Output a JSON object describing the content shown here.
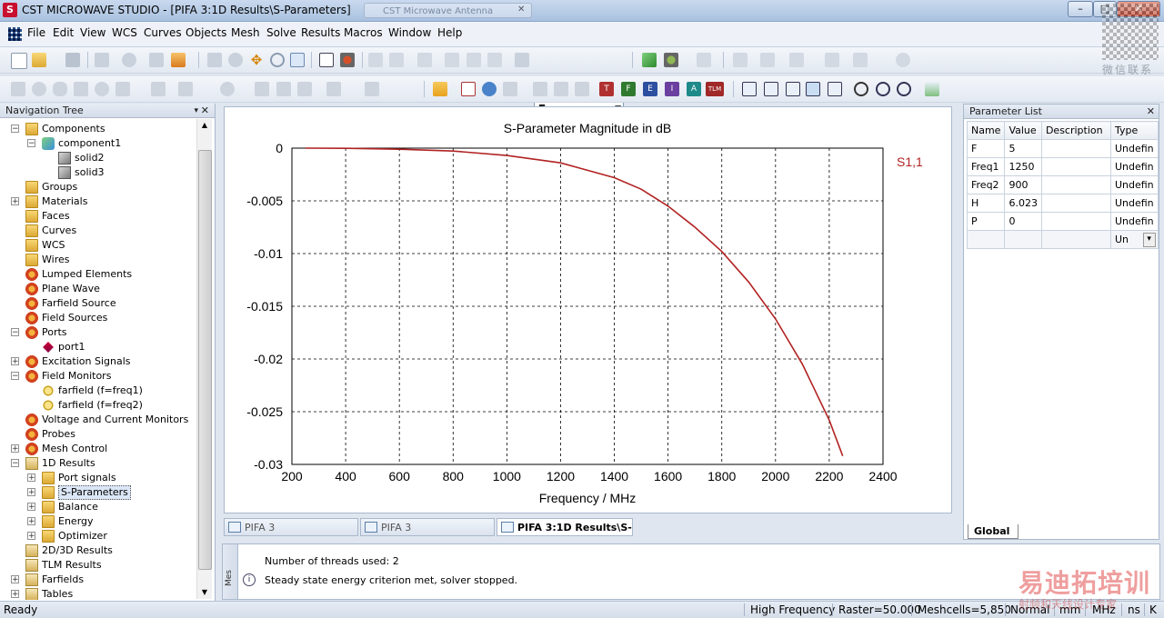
{
  "window": {
    "title": "CST MICROWAVE STUDIO - [PIFA 3:1D Results\\S-Parameters]",
    "ghost_tab": "CST Microwave Antenna",
    "logo": "S"
  },
  "menu": [
    "File",
    "Edit",
    "View",
    "WCS",
    "Curves",
    "Objects",
    "Mesh",
    "Solve",
    "Results",
    "Macros",
    "Window",
    "Help"
  ],
  "toolbar": {
    "mode_value": "Free"
  },
  "nav_tree": {
    "title": "Navigation Tree",
    "items": [
      {
        "label": "Components",
        "level": 0,
        "exp": "-",
        "icon": "folder"
      },
      {
        "label": "component1",
        "level": 1,
        "exp": "-",
        "icon": "component"
      },
      {
        "label": "solid2",
        "level": 2,
        "exp": "",
        "icon": "solid"
      },
      {
        "label": "solid3",
        "level": 2,
        "exp": "",
        "icon": "solid"
      },
      {
        "label": "Groups",
        "level": 0,
        "exp": "",
        "icon": "folder"
      },
      {
        "label": "Materials",
        "level": 0,
        "exp": "+",
        "icon": "folder"
      },
      {
        "label": "Faces",
        "level": 0,
        "exp": "",
        "icon": "folder"
      },
      {
        "label": "Curves",
        "level": 0,
        "exp": "",
        "icon": "folder"
      },
      {
        "label": "WCS",
        "level": 0,
        "exp": "",
        "icon": "folder"
      },
      {
        "label": "Wires",
        "level": 0,
        "exp": "",
        "icon": "folder"
      },
      {
        "label": "Lumped Elements",
        "level": 0,
        "exp": "",
        "icon": "gear"
      },
      {
        "label": "Plane Wave",
        "level": 0,
        "exp": "",
        "icon": "gear"
      },
      {
        "label": "Farfield Source",
        "level": 0,
        "exp": "",
        "icon": "gear"
      },
      {
        "label": "Field Sources",
        "level": 0,
        "exp": "",
        "icon": "gear"
      },
      {
        "label": "Ports",
        "level": 0,
        "exp": "-",
        "icon": "gear"
      },
      {
        "label": "port1",
        "level": 1,
        "exp": "",
        "icon": "port"
      },
      {
        "label": "Excitation Signals",
        "level": 0,
        "exp": "+",
        "icon": "gear"
      },
      {
        "label": "Field Monitors",
        "level": 0,
        "exp": "-",
        "icon": "gear"
      },
      {
        "label": "farfield (f=freq1)",
        "level": 1,
        "exp": "",
        "icon": "farfield"
      },
      {
        "label": "farfield (f=freq2)",
        "level": 1,
        "exp": "",
        "icon": "farfield"
      },
      {
        "label": "Voltage and Current Monitors",
        "level": 0,
        "exp": "",
        "icon": "gear"
      },
      {
        "label": "Probes",
        "level": 0,
        "exp": "",
        "icon": "gear"
      },
      {
        "label": "Mesh Control",
        "level": 0,
        "exp": "+",
        "icon": "gear"
      },
      {
        "label": "1D Results",
        "level": 0,
        "exp": "-",
        "icon": "result"
      },
      {
        "label": "Port signals",
        "level": 1,
        "exp": "+",
        "icon": "folder"
      },
      {
        "label": "S-Parameters",
        "level": 1,
        "exp": "+",
        "icon": "folder",
        "selected": true
      },
      {
        "label": "Balance",
        "level": 1,
        "exp": "+",
        "icon": "folder"
      },
      {
        "label": "Energy",
        "level": 1,
        "exp": "+",
        "icon": "folder"
      },
      {
        "label": "Optimizer",
        "level": 1,
        "exp": "+",
        "icon": "folder"
      },
      {
        "label": "2D/3D Results",
        "level": 0,
        "exp": "",
        "icon": "result"
      },
      {
        "label": "TLM Results",
        "level": 0,
        "exp": "",
        "icon": "result"
      },
      {
        "label": "Farfields",
        "level": 0,
        "exp": "+",
        "icon": "result"
      },
      {
        "label": "Tables",
        "level": 0,
        "exp": "+",
        "icon": "result"
      }
    ]
  },
  "chart_data": {
    "type": "line",
    "title": "S-Parameter Magnitude in dB",
    "xlabel": "Frequency / MHz",
    "ylabel": "",
    "xlim": [
      200,
      2400
    ],
    "ylim": [
      -0.03,
      0
    ],
    "x_ticks": [
      "200",
      "400",
      "600",
      "800",
      "1000",
      "1200",
      "1400",
      "1600",
      "1800",
      "2000",
      "2200",
      "2400"
    ],
    "y_ticks": [
      "0",
      "-0.005",
      "-0.01",
      "-0.015",
      "-0.02",
      "-0.025",
      "-0.03"
    ],
    "grid": true,
    "legend_position": "right",
    "series": [
      {
        "name": "S1,1",
        "color": "#b22222",
        "x": [
          250,
          400,
          600,
          800,
          1000,
          1200,
          1400,
          1500,
          1600,
          1700,
          1800,
          1900,
          2000,
          2100,
          2200,
          2250
        ],
        "y": [
          0,
          -2e-05,
          -0.0001,
          -0.00028,
          -0.0007,
          -0.0014,
          -0.0028,
          -0.0039,
          -0.0055,
          -0.0075,
          -0.0098,
          -0.0127,
          -0.0162,
          -0.0205,
          -0.0258,
          -0.0292
        ]
      }
    ]
  },
  "doc_tabs": [
    {
      "label": "PIFA 3",
      "active": false
    },
    {
      "label": "PIFA 3",
      "active": false
    },
    {
      "label": "PIFA 3:1D Results\\S-...",
      "active": true
    }
  ],
  "parameters": {
    "title": "Parameter List",
    "headers": [
      "Name",
      "Value",
      "Description",
      "Type"
    ],
    "rows": [
      [
        "F",
        "5",
        "",
        "Undefin"
      ],
      [
        "Freq1",
        "1250",
        "",
        "Undefin"
      ],
      [
        "Freq2",
        "900",
        "",
        "Undefin"
      ],
      [
        "H",
        "6.023",
        "",
        "Undefin"
      ],
      [
        "P",
        "0",
        "",
        "Undefin"
      ],
      [
        "",
        "",
        "",
        "Un"
      ]
    ],
    "tab": "Global"
  },
  "messages": {
    "side_label": "Mes",
    "lines": [
      "Number of threads used: 2",
      "Steady state energy criterion met, solver stopped."
    ]
  },
  "status": {
    "left": "Ready",
    "items": [
      "High Frequency",
      "Raster=50.000",
      "Meshcells=5,850",
      "Normal",
      "mm",
      "MHz",
      "ns",
      "K"
    ]
  },
  "watermark": {
    "wechat": "微信联系",
    "brand": "易迪拓培训",
    "sub": "射频和天线设计专家"
  }
}
